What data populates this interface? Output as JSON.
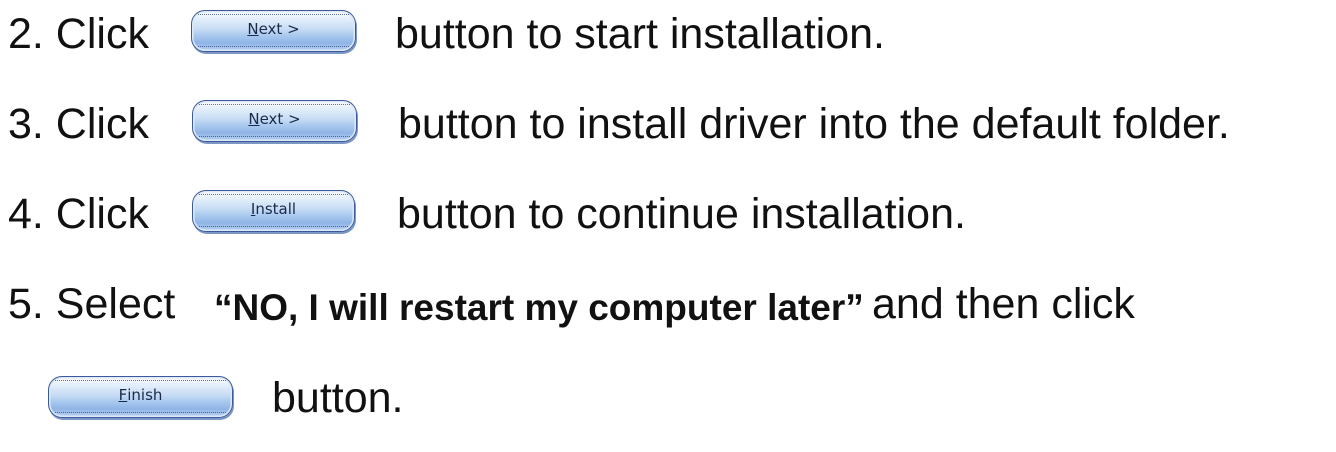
{
  "steps": [
    {
      "prefix": "2. Click",
      "button": {
        "mnemonic": "N",
        "rest": "ext >"
      },
      "suffix": "button to start installation."
    },
    {
      "prefix": "3. Click",
      "button": {
        "mnemonic": "N",
        "rest": "ext >"
      },
      "suffix": "button to install driver into the default folder."
    },
    {
      "prefix": "4. Click",
      "button": {
        "mnemonic": "I",
        "rest": "nstall"
      },
      "suffix": "button to continue installation."
    },
    {
      "prefix": "5. Select",
      "bold_text": "“NO, I will restart my computer later”",
      "middle": "and then click",
      "button": {
        "mnemonic": "F",
        "rest": "inish"
      },
      "suffix": "button."
    }
  ]
}
